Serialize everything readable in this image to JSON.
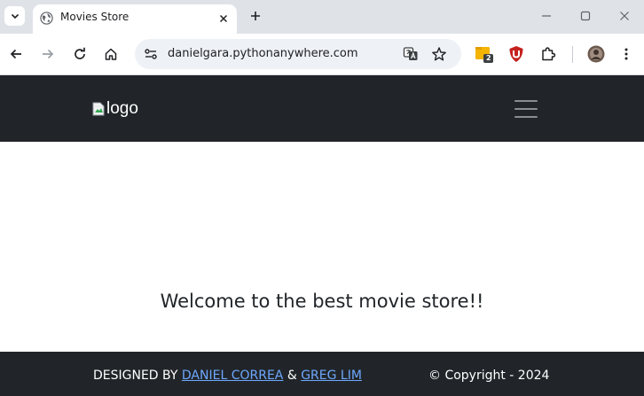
{
  "browser": {
    "tab": {
      "title": "Movies Store",
      "favicon": "globe-icon"
    },
    "address_bar": {
      "url": "danielgara.pythonanywhere.com"
    },
    "extensions": [
      "folder-extension-icon",
      "ublock-icon",
      "puzzle-extensions-icon"
    ],
    "extension_badge": "2"
  },
  "site": {
    "navbar": {
      "logo_alt": "logo",
      "menu_icon": "hamburger-icon"
    },
    "hero": {
      "title": "Welcome to the best movie store!!"
    },
    "footer": {
      "designed_by": "DESIGNED BY",
      "author1": "DANIEL CORREA",
      "separator": "&",
      "author2": "GREG LIM",
      "copyright": "© Copyright - 2024"
    }
  },
  "colors": {
    "navbar_bg": "#212529",
    "footer_bg": "#212529",
    "link": "#6ea8fe",
    "tabstrip_bg": "#dfe3e8"
  }
}
